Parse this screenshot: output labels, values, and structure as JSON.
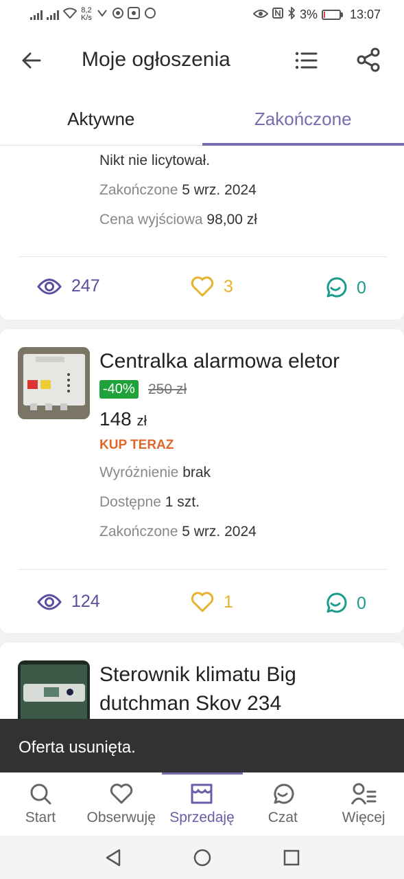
{
  "status_bar": {
    "speed_value": "8,2",
    "speed_unit": "K/s",
    "battery": "3%",
    "time": "13:07"
  },
  "header": {
    "title": "Moje ogłoszenia"
  },
  "tabs": [
    {
      "label": "Aktywne",
      "active": false
    },
    {
      "label": "Zakończone",
      "active": true
    }
  ],
  "listings": [
    {
      "lines": [
        {
          "label": "",
          "value": "Nikt nie licytował."
        },
        {
          "label": "Zakończone",
          "value": "5 wrz. 2024"
        },
        {
          "label": "Cena wyjściowa",
          "value": "98,00 zł"
        }
      ],
      "stats": {
        "views": "247",
        "favorites": "3",
        "messages": "0"
      }
    },
    {
      "title": "Centralka alarmowa eletor",
      "discount": "-40%",
      "old_price": "250 zł",
      "price": "148",
      "currency": "zł",
      "buy_type": "KUP TERAZ",
      "lines": [
        {
          "label": "Wyróżnienie",
          "value": "brak"
        },
        {
          "label": "Dostępne",
          "value": "1",
          "suffix": "szt."
        },
        {
          "label": "Zakończone",
          "value": "5 wrz. 2024"
        }
      ],
      "stats": {
        "views": "124",
        "favorites": "1",
        "messages": "0"
      }
    },
    {
      "title_line1": "Sterownik klimatu Big",
      "title_line2": "dutchman Skov 234"
    }
  ],
  "snackbar": {
    "text": "Oferta usunięta."
  },
  "bottom_nav": [
    {
      "label": "Start",
      "icon": "search-icon"
    },
    {
      "label": "Obserwuję",
      "icon": "heart-icon"
    },
    {
      "label": "Sprzedaję",
      "icon": "store-icon",
      "active": true
    },
    {
      "label": "Czat",
      "icon": "chat-icon"
    },
    {
      "label": "Więcej",
      "icon": "user-menu-icon"
    }
  ],
  "colors": {
    "accent": "#7a6ab0",
    "views": "#5b4d9e",
    "favorites": "#e8b12e",
    "messages": "#1a9c8c",
    "discount_bg": "#1fa23a",
    "buy_now": "#e0672a"
  }
}
